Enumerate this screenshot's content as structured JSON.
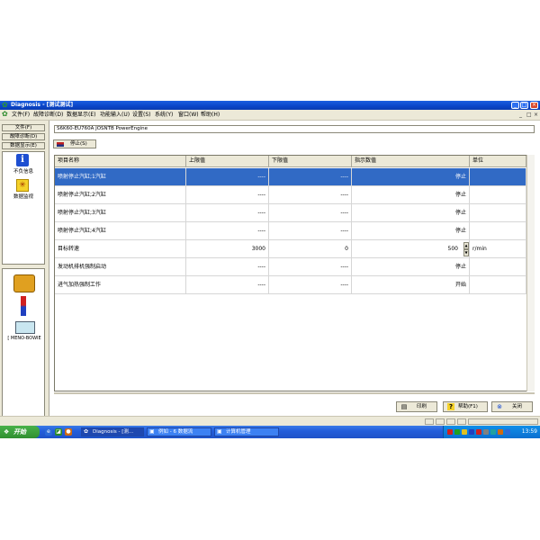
{
  "window": {
    "title": "Diagnosis - [测试测试]",
    "controls": [
      "_",
      "□",
      "×"
    ]
  },
  "menubar": {
    "items": [
      "文件(F)",
      "故障诊断(D)",
      "数据显示(E)",
      "功能输入(U)",
      "设置(S)",
      "系统(Y)",
      "窗口(W)",
      "帮助(H)"
    ],
    "mdi_controls": [
      "_",
      "□",
      "×"
    ]
  },
  "sidebar": {
    "buttons": [
      "文件(F)",
      "故障诊断(D)",
      "数据显示(E)"
    ],
    "items": [
      {
        "icon": "info-icon",
        "label": "不负信息"
      },
      {
        "icon": "data-monitor-icon",
        "label": "数据监视"
      }
    ],
    "device_label": "[ MENO-BOWIE"
  },
  "engine": {
    "label": "S6K60-EU760A JOSNTB PowerEngine"
  },
  "toolbar": {
    "stop_label": "停止(S)"
  },
  "table": {
    "headers": [
      "项目名称",
      "上限值",
      "下限值",
      "指示数值",
      "单位"
    ],
    "rows": [
      {
        "name": "喷射停止汽缸;1汽缸",
        "upper": "----",
        "lower": "----",
        "value": "停止",
        "unit": "",
        "selected": true
      },
      {
        "name": "喷射停止汽缸;2汽缸",
        "upper": "----",
        "lower": "----",
        "value": "停止",
        "unit": ""
      },
      {
        "name": "喷射停止汽缸;3汽缸",
        "upper": "----",
        "lower": "----",
        "value": "停止",
        "unit": ""
      },
      {
        "name": "喷射停止汽缸;4汽缸",
        "upper": "----",
        "lower": "----",
        "value": "停止",
        "unit": ""
      },
      {
        "name": "目标转速",
        "upper": "3000",
        "lower": "0",
        "value": "500",
        "unit": "r/min",
        "spinner": true
      },
      {
        "name": "发动机排机强制启动",
        "upper": "----",
        "lower": "----",
        "value": "停止",
        "unit": ""
      },
      {
        "name": "进气加热强制工作",
        "upper": "----",
        "lower": "----",
        "value": "开始",
        "unit": ""
      }
    ]
  },
  "footer": {
    "print_label": "印刷",
    "help_label": "帮助(F1)",
    "close_label": "关闭"
  },
  "taskbar": {
    "start_label": "开始",
    "tasks": [
      "Diagnosis - [测...",
      "例如 - 6 数据流",
      "计算机管理"
    ],
    "clock": "13:59"
  },
  "colors": {
    "titlebar": "#0a45c8",
    "selection": "#316ac5",
    "chrome": "#ece9d8",
    "taskbar": "#245edb",
    "start": "#3a9a3a"
  }
}
